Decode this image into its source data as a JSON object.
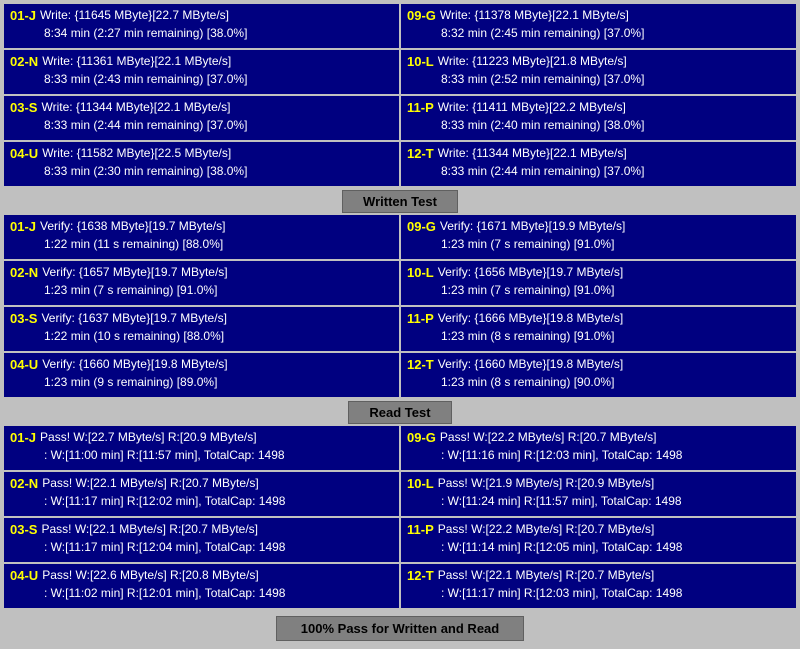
{
  "sections": {
    "write_test": {
      "label": "Written Test",
      "rows": [
        {
          "left_id": "01-J",
          "left_line1": "Write: {11645 MByte}[22.7 MByte/s]",
          "left_line2": "8:34 min (2:27 min remaining)  [38.0%]",
          "right_id": "09-G",
          "right_line1": "Write: {11378 MByte}[22.1 MByte/s]",
          "right_line2": "8:32 min (2:45 min remaining)  [37.0%]"
        },
        {
          "left_id": "02-N",
          "left_line1": "Write: {11361 MByte}[22.1 MByte/s]",
          "left_line2": "8:33 min (2:43 min remaining)  [37.0%]",
          "right_id": "10-L",
          "right_line1": "Write: {11223 MByte}[21.8 MByte/s]",
          "right_line2": "8:33 min (2:52 min remaining)  [37.0%]"
        },
        {
          "left_id": "03-S",
          "left_line1": "Write: {11344 MByte}[22.1 MByte/s]",
          "left_line2": "8:33 min (2:44 min remaining)  [37.0%]",
          "right_id": "11-P",
          "right_line1": "Write: {11411 MByte}[22.2 MByte/s]",
          "right_line2": "8:33 min (2:40 min remaining)  [38.0%]"
        },
        {
          "left_id": "04-U",
          "left_line1": "Write: {11582 MByte}[22.5 MByte/s]",
          "left_line2": "8:33 min (2:30 min remaining)  [38.0%]",
          "right_id": "12-T",
          "right_line1": "Write: {11344 MByte}[22.1 MByte/s]",
          "right_line2": "8:33 min (2:44 min remaining)  [37.0%]"
        }
      ]
    },
    "verify_test": {
      "label": "Written Test",
      "rows": [
        {
          "left_id": "01-J",
          "left_line1": "Verify: {1638 MByte}[19.7 MByte/s]",
          "left_line2": "1:22 min (11 s remaining)  [88.0%]",
          "right_id": "09-G",
          "right_line1": "Verify: {1671 MByte}[19.9 MByte/s]",
          "right_line2": "1:23 min (7 s remaining)  [91.0%]"
        },
        {
          "left_id": "02-N",
          "left_line1": "Verify: {1657 MByte}[19.7 MByte/s]",
          "left_line2": "1:23 min (7 s remaining)  [91.0%]",
          "right_id": "10-L",
          "right_line1": "Verify: {1656 MByte}[19.7 MByte/s]",
          "right_line2": "1:23 min (7 s remaining)  [91.0%]"
        },
        {
          "left_id": "03-S",
          "left_line1": "Verify: {1637 MByte}[19.7 MByte/s]",
          "left_line2": "1:22 min (10 s remaining)  [88.0%]",
          "right_id": "11-P",
          "right_line1": "Verify: {1666 MByte}[19.8 MByte/s]",
          "right_line2": "1:23 min (8 s remaining)  [91.0%]"
        },
        {
          "left_id": "04-U",
          "left_line1": "Verify: {1660 MByte}[19.8 MByte/s]",
          "left_line2": "1:23 min (9 s remaining)  [89.0%]",
          "right_id": "12-T",
          "right_line1": "Verify: {1660 MByte}[19.8 MByte/s]",
          "right_line2": "1:23 min (8 s remaining)  [90.0%]"
        }
      ]
    },
    "read_test": {
      "label": "Read Test",
      "rows": [
        {
          "left_id": "01-J",
          "left_line1": "Pass! W:[22.7 MByte/s] R:[20.9 MByte/s]",
          "left_line2": ": W:[11:00 min] R:[11:57 min], TotalCap: 1498",
          "right_id": "09-G",
          "right_line1": "Pass! W:[22.2 MByte/s] R:[20.7 MByte/s]",
          "right_line2": ": W:[11:16 min] R:[12:03 min], TotalCap: 1498"
        },
        {
          "left_id": "02-N",
          "left_line1": "Pass! W:[22.1 MByte/s] R:[20.7 MByte/s]",
          "left_line2": ": W:[11:17 min] R:[12:02 min], TotalCap: 1498",
          "right_id": "10-L",
          "right_line1": "Pass! W:[21.9 MByte/s] R:[20.9 MByte/s]",
          "right_line2": ": W:[11:24 min] R:[11:57 min], TotalCap: 1498"
        },
        {
          "left_id": "03-S",
          "left_line1": "Pass! W:[22.1 MByte/s] R:[20.7 MByte/s]",
          "left_line2": ": W:[11:17 min] R:[12:04 min], TotalCap: 1498",
          "right_id": "11-P",
          "right_line1": "Pass! W:[22.2 MByte/s] R:[20.7 MByte/s]",
          "right_line2": ": W:[11:14 min] R:[12:05 min], TotalCap: 1498"
        },
        {
          "left_id": "04-U",
          "left_line1": "Pass! W:[22.6 MByte/s] R:[20.8 MByte/s]",
          "left_line2": ": W:[11:02 min] R:[12:01 min], TotalCap: 1498",
          "right_id": "12-T",
          "right_line1": "Pass! W:[22.1 MByte/s] R:[20.7 MByte/s]",
          "right_line2": ": W:[11:17 min] R:[12:03 min], TotalCap: 1498"
        }
      ]
    }
  },
  "headers": {
    "written_test": "Written Test",
    "read_test": "Read Test",
    "footer": "100% Pass for Written and Read"
  }
}
